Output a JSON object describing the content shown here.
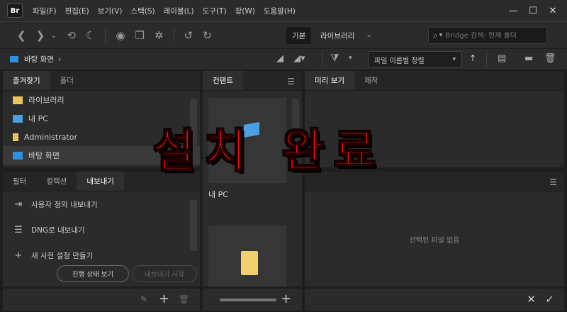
{
  "app": {
    "logo": "Br",
    "menu": [
      "파일(F)",
      "편집(E)",
      "보기(V)",
      "스택(S)",
      "레이블(L)",
      "도구(T)",
      "창(W)",
      "도움말(H)"
    ]
  },
  "toolbar": {
    "workspace_active": "기본",
    "workspace_library": "라이브러리",
    "search_placeholder": "Bridge 검색: 현재 폴더"
  },
  "pathbar": {
    "folder": "바탕 화면",
    "sort_label": "파일 이름별 정렬"
  },
  "favorites": {
    "tabs": [
      "즐겨찾기",
      "폴더"
    ],
    "items": [
      {
        "label": "라이브러리",
        "icon": "library-folder-icon",
        "color": "#e8c35a"
      },
      {
        "label": "내 PC",
        "icon": "computer-icon",
        "color": "#4aa0e0"
      },
      {
        "label": "Administrator",
        "icon": "user-folder-icon",
        "color": "#e8c35a"
      },
      {
        "label": "바탕 화면",
        "icon": "desktop-icon",
        "color": "#2f8fe0"
      }
    ]
  },
  "export": {
    "tabs": [
      "필터",
      "컬렉션",
      "내보내기"
    ],
    "items": [
      {
        "label": "사용자 정의 내보내기",
        "icon": "export-icon"
      },
      {
        "label": "DNG로 내보내기",
        "icon": "list-icon"
      },
      {
        "label": "새 사전 설정 만들기",
        "icon": "plus-icon"
      }
    ],
    "progress_button": "진행 상태 보기",
    "start_button": "내보내기 시작"
  },
  "content": {
    "tab": "컨텐트",
    "items": [
      {
        "label": "내 PC"
      },
      {
        "label": ""
      }
    ]
  },
  "preview": {
    "tabs": [
      "미리 보기",
      "제작"
    ],
    "empty_text": "선택된 파일 없음"
  },
  "overlay_text": "설치 완료",
  "colors": {
    "accent": "#ff1a1a",
    "panel": "#2b2b2b",
    "bg": "#1e1e1e"
  }
}
